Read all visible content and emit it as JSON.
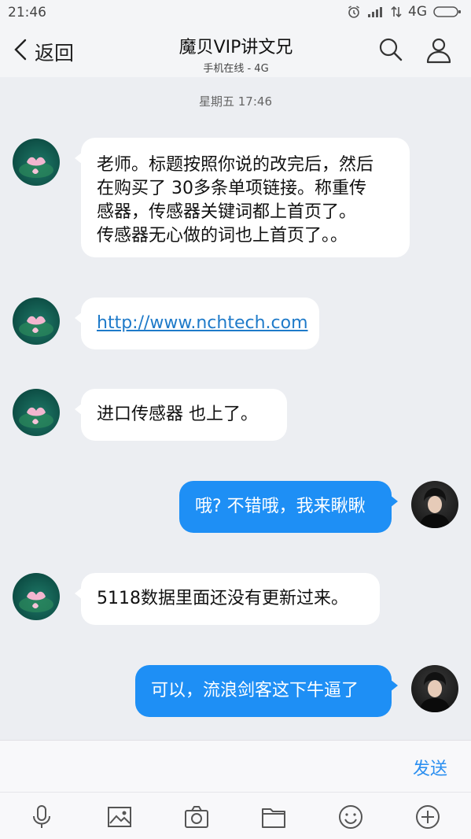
{
  "status_bar": {
    "time": "21:46",
    "network": "4G",
    "icons": [
      "alarm-icon",
      "signal-icon",
      "data-arrows-icon",
      "battery-icon"
    ]
  },
  "header": {
    "back_label": "返回",
    "title": "魔贝VIP讲文兄",
    "subtitle": "手机在线 - 4G",
    "icons": [
      "search-icon",
      "profile-icon"
    ]
  },
  "chat": {
    "timestamp": "星期五 17:46",
    "messages": [
      {
        "side": "in",
        "lines": [
          "老师。标题按照你说的改完后，然后",
          "在购买了 30多条单项链接。称重传",
          "感器，传感器关键词都上首页了。",
          "传感器无心做的词也上首页了。。"
        ]
      },
      {
        "side": "in",
        "link": "http://www.nchtech.com"
      },
      {
        "side": "in",
        "text": "进口传感器 也上了。"
      },
      {
        "side": "out",
        "text": "哦? 不错哦，我来瞅瞅"
      },
      {
        "side": "in",
        "text": "5118数据里面还没有更新过来。"
      },
      {
        "side": "out",
        "text": "可以，流浪剑客这下牛逼了"
      }
    ]
  },
  "input": {
    "send_label": "发送"
  },
  "toolbar": {
    "icons": [
      "microphone-icon",
      "image-icon",
      "camera-icon",
      "folder-icon",
      "emoji-icon",
      "plus-icon"
    ]
  },
  "colors": {
    "outgoing_bubble": "#1e8ff5",
    "incoming_bubble": "#ffffff",
    "background": "#eceef2",
    "accent": "#2b8ff0"
  }
}
